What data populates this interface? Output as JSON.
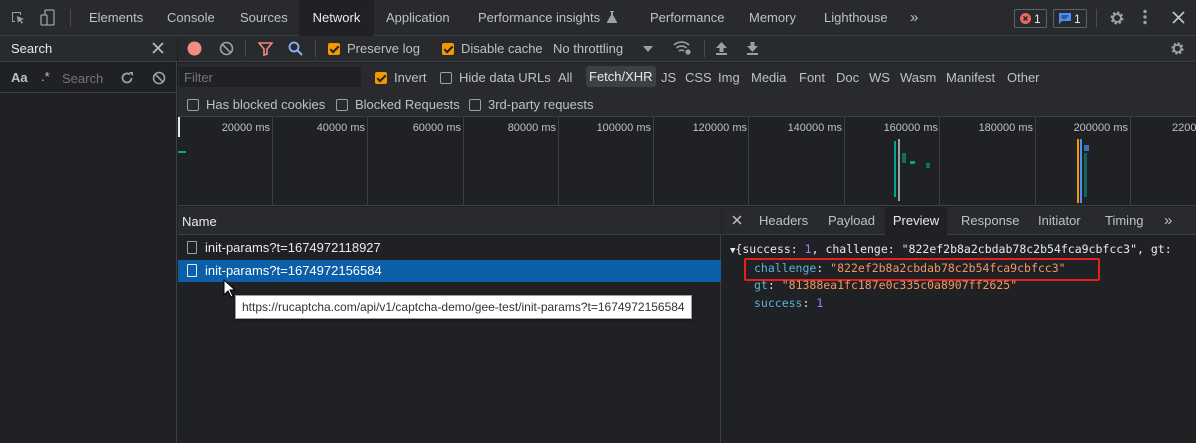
{
  "top_tabs": [
    "Elements",
    "Console",
    "Sources",
    "Network",
    "Application",
    "Performance insights",
    "Performance",
    "Memory",
    "Lighthouse"
  ],
  "active_top_tab": "Network",
  "badges": {
    "errors": "1",
    "messages": "1"
  },
  "sidebar": {
    "title": "Search",
    "case_label": "Aa",
    "regex_label": ".*",
    "search_placeholder": "Search"
  },
  "toolbar": {
    "preserve_log": "Preserve log",
    "disable_cache": "Disable cache",
    "throttling": "No throttling"
  },
  "filter": {
    "placeholder": "Filter",
    "invert": "Invert",
    "hide_data_urls": "Hide data URLs",
    "types": [
      "All",
      "Fetch/XHR",
      "JS",
      "CSS",
      "Img",
      "Media",
      "Font",
      "Doc",
      "WS",
      "Wasm",
      "Manifest",
      "Other"
    ],
    "active_type": "Fetch/XHR"
  },
  "filter2": {
    "blocked_cookies": "Has blocked cookies",
    "blocked_requests": "Blocked Requests",
    "third_party": "3rd-party requests"
  },
  "timeline": {
    "ticks": [
      "20000 ms",
      "40000 ms",
      "60000 ms",
      "80000 ms",
      "100000 ms",
      "120000 ms",
      "140000 ms",
      "160000 ms",
      "180000 ms",
      "200000 ms",
      "2200"
    ]
  },
  "requests": {
    "header": "Name",
    "rows": [
      "init-params?t=1674972118927",
      "init-params?t=1674972156584"
    ],
    "tooltip": "https://rucaptcha.com/api/v1/captcha-demo/gee-test/init-params?t=1674972156584"
  },
  "detail_tabs": [
    "Headers",
    "Payload",
    "Preview",
    "Response",
    "Initiator",
    "Timing"
  ],
  "active_detail_tab": "Preview",
  "preview": {
    "summary_open": "{success: ",
    "summary_success": "1",
    "summary_mid": ", challenge: ",
    "summary_challenge": "\"822ef2b8a2cbdab78c2b54fca9cbfcc3\"",
    "summary_tail": ", gt:",
    "challenge_key": "challenge",
    "challenge_value": "\"822ef2b8a2cbdab78c2b54fca9cbfcc3\"",
    "gt_key": "gt",
    "gt_value": "\"81388ea1fc187e0c335c0a8907ff2625\"",
    "success_key": "success",
    "success_value": "1"
  },
  "colors": {
    "accent_blue": "#0b5ea8",
    "highlight_red": "#e8201c",
    "record_red": "#f28b82",
    "checkbox_orange": "#f29900"
  }
}
